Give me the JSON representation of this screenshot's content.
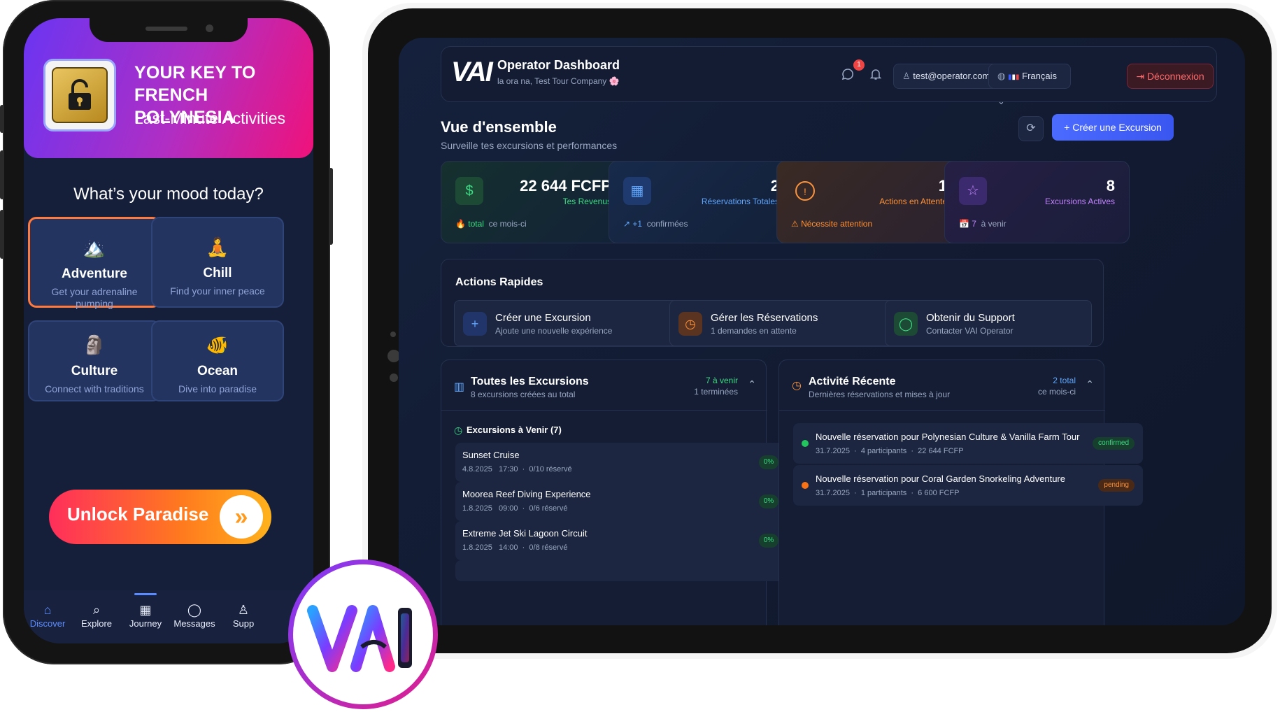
{
  "phone": {
    "hero": {
      "title_line1": "YOUR KEY TO",
      "title_line2": "FRENCH POLYNESIA",
      "subtitle": "Last-Minute Activities"
    },
    "mood_question": "What’s your mood today?",
    "moods": [
      {
        "title": "Adventure",
        "subtitle": "Get your adrenaline pumping",
        "icon": "mountain-icon",
        "emoji": "🏔️",
        "selected": true
      },
      {
        "title": "Chill",
        "subtitle": "Find your inner peace",
        "icon": "meditation-icon",
        "emoji": "🧘",
        "selected": false
      },
      {
        "title": "Culture",
        "subtitle": "Connect with traditions",
        "icon": "moai-icon",
        "emoji": "🗿",
        "selected": false
      },
      {
        "title": "Ocean",
        "subtitle": "Dive into paradise",
        "icon": "fish-icon",
        "emoji": "🐠",
        "selected": false
      }
    ],
    "cta": {
      "label": "Unlock Paradise",
      "arrow": "»"
    },
    "tabs": [
      {
        "label": "Discover",
        "icon": "home-icon",
        "glyph": "⌂",
        "active": true
      },
      {
        "label": "Explore",
        "icon": "search-icon",
        "glyph": "⌕",
        "active": false
      },
      {
        "label": "Journey",
        "icon": "calendar-icon",
        "glyph": "▦",
        "active": false
      },
      {
        "label": "Messages",
        "icon": "chat-icon",
        "glyph": "◯",
        "active": false
      },
      {
        "label": "Supp",
        "icon": "user-icon",
        "glyph": "♙",
        "active": false
      }
    ]
  },
  "dashboard": {
    "header": {
      "logo": "VAI",
      "title": "Operator Dashboard",
      "subtitle": "la ora na, Test Tour Company 🌸",
      "notif_count": "1",
      "user_email": "test@operator.com",
      "language": "Français",
      "logout": "Déconnexion"
    },
    "overview": {
      "title": "Vue d'ensemble",
      "subtitle": "Surveille tes excursions et performances",
      "refresh_icon": "refresh-icon",
      "create_label": "Créer une Excursion"
    },
    "stats": [
      {
        "value": "22 644 FCFP",
        "label": "Tes Revenus",
        "foot_a": "total",
        "foot_b": "ce mois-ci",
        "icon": "dollar-icon",
        "glyph": "$",
        "accent": "#22c55e"
      },
      {
        "value": "2",
        "label": "Réservations Totales",
        "foot_a": "↗ +1",
        "foot_b": "confirmées",
        "icon": "calendar-icon",
        "glyph": "▦",
        "accent": "#3b82f6"
      },
      {
        "value": "1",
        "label": "Actions en Attente",
        "foot_a": "⚠ Nécessite attention",
        "foot_b": "",
        "icon": "alert-icon",
        "glyph": "!",
        "accent": "#f97316"
      },
      {
        "value": "8",
        "label": "Excursions Actives",
        "foot_a": "📅 7",
        "foot_b": "à venir",
        "icon": "star-icon",
        "glyph": "☆",
        "accent": "#a855f7"
      }
    ],
    "quick_actions": {
      "title": "Actions Rapides",
      "items": [
        {
          "title": "Créer une Excursion",
          "subtitle": "Ajoute une nouvelle expérience",
          "icon": "plus-icon",
          "glyph": "+"
        },
        {
          "title": "Gérer les Réservations",
          "subtitle": "1 demandes en attente",
          "icon": "clock-icon",
          "glyph": "◷"
        },
        {
          "title": "Obtenir du Support",
          "subtitle": "Contacter VAI Operator",
          "icon": "chat-icon",
          "glyph": "◯"
        }
      ]
    },
    "excursions": {
      "title": "Toutes les Excursions",
      "subtitle": "8 excursions créées au total",
      "upcoming_count": "7 à venir",
      "done_count": "1 terminées",
      "upcoming_title": "Excursions à Venir (7)",
      "items": [
        {
          "name": "Sunset Cruise",
          "date": "4.8.2025",
          "time": "17:30",
          "booked": "0/10 réservé",
          "pct": "0%"
        },
        {
          "name": "Moorea Reef Diving Experience",
          "date": "1.8.2025",
          "time": "09:00",
          "booked": "0/6 réservé",
          "pct": "0%"
        },
        {
          "name": "Extreme Jet Ski Lagoon Circuit",
          "date": "1.8.2025",
          "time": "14:00",
          "booked": "0/8 réservé",
          "pct": "0%"
        }
      ]
    },
    "activity": {
      "title": "Activité Récente",
      "subtitle": "Dernières réservations et mises à jour",
      "total": "2 total",
      "period": "ce mois-ci",
      "items": [
        {
          "text": "Nouvelle réservation pour Polynesian Culture & Vanilla Farm Tour",
          "date": "31.7.2025",
          "participants": "4 participants",
          "amount": "22 644 FCFP",
          "status": "confirmed",
          "color": "#22c55e"
        },
        {
          "text": "Nouvelle réservation pour Coral Garden Snorkeling Adventure",
          "date": "31.7.2025",
          "participants": "1 participants",
          "amount": "6 600 FCFP",
          "status": "pending",
          "color": "#f97316"
        }
      ]
    }
  },
  "brand_logo": "VAI"
}
